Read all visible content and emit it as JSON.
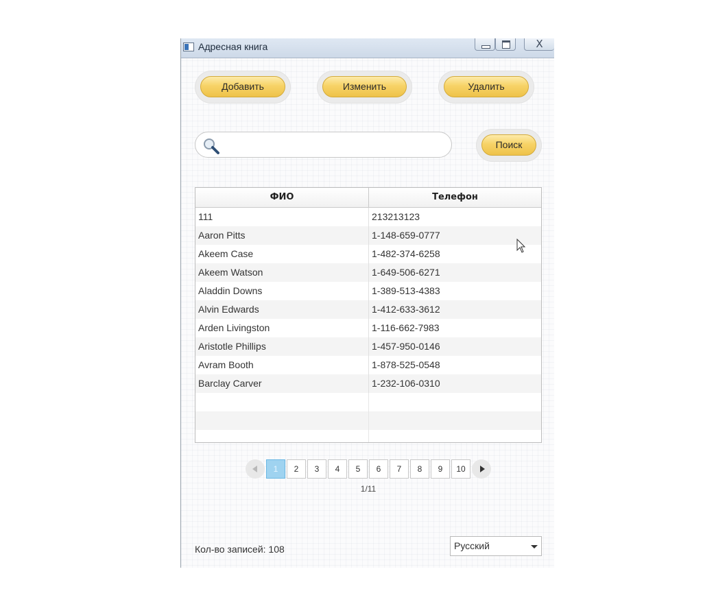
{
  "window": {
    "title": "Адресная книга",
    "close_glyph": "X"
  },
  "toolbar": {
    "add_label": "Добавить",
    "edit_label": "Изменить",
    "delete_label": "Удалить"
  },
  "search": {
    "value": "",
    "placeholder": "",
    "button_label": "Поиск"
  },
  "table": {
    "columns": [
      "ФИО",
      "Телефон"
    ],
    "rows": [
      [
        "111",
        "213213123"
      ],
      [
        "Aaron Pitts",
        "1-148-659-0777"
      ],
      [
        "Akeem Case",
        "1-482-374-6258"
      ],
      [
        "Akeem Watson",
        "1-649-506-6271"
      ],
      [
        "Aladdin Downs",
        "1-389-513-4383"
      ],
      [
        "Alvin Edwards",
        "1-412-633-3612"
      ],
      [
        "Arden Livingston",
        "1-116-662-7983"
      ],
      [
        "Aristotle Phillips",
        "1-457-950-0146"
      ],
      [
        "Avram Booth",
        "1-878-525-0548"
      ],
      [
        "Barclay Carver",
        "1-232-106-0310"
      ]
    ]
  },
  "pager": {
    "pages": [
      "1",
      "2",
      "3",
      "4",
      "5",
      "6",
      "7",
      "8",
      "9",
      "10"
    ],
    "active": "1",
    "info": "1/11"
  },
  "footer": {
    "count_label": "Кол-во записей: 108",
    "language": "Русский"
  },
  "colors": {
    "button_gold": "#f7d367",
    "active_page": "#9fd3f0"
  },
  "icons": {
    "search": "magnifier-icon",
    "prev": "arrow-left-icon",
    "next": "arrow-right-icon"
  }
}
